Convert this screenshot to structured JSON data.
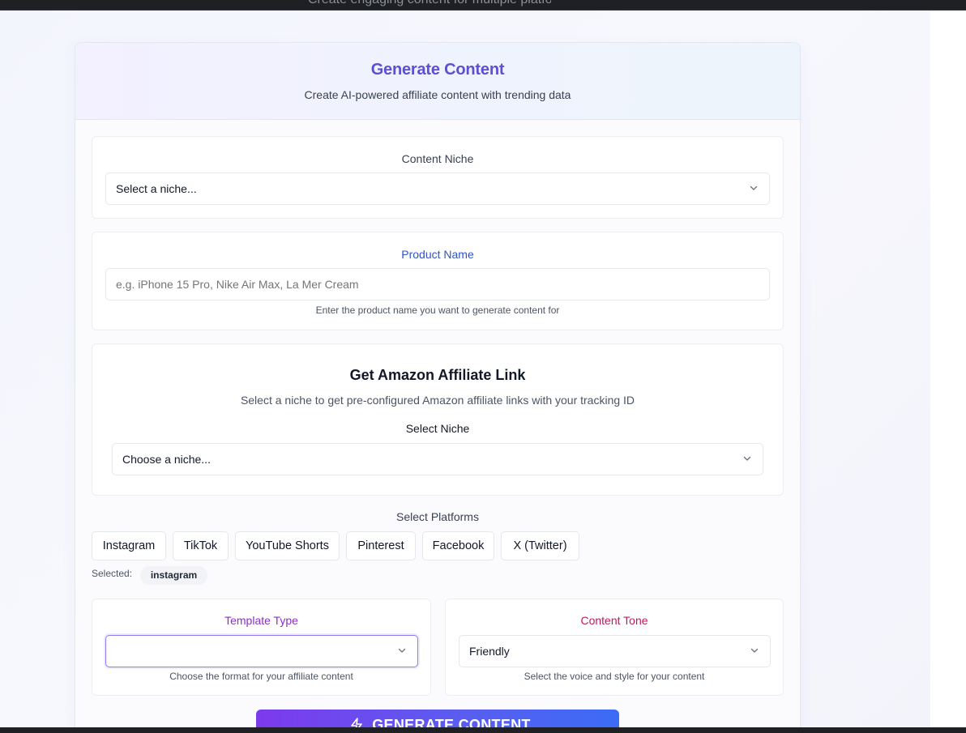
{
  "top_fragment": "Create engaging content for multiple platforms",
  "header": {
    "title": "Generate Content",
    "subtitle": "Create AI-powered affiliate content with trending data"
  },
  "content_niche": {
    "label": "Content Niche",
    "value": "Select a niche..."
  },
  "product_name": {
    "label": "Product Name",
    "placeholder": "e.g. iPhone 15 Pro, Nike Air Max, La Mer Cream",
    "helper": "Enter the product name you want to generate content for"
  },
  "amazon": {
    "title": "Get Amazon Affiliate Link",
    "subtitle": "Select a niche to get pre-configured Amazon affiliate links with your tracking ID",
    "select_label": "Select Niche",
    "value": "Choose a niche..."
  },
  "platforms": {
    "label": "Select Platforms",
    "items": [
      "Instagram",
      "TikTok",
      "YouTube Shorts",
      "Pinterest",
      "Facebook",
      "X (Twitter)"
    ],
    "selected_label": "Selected:",
    "selected": [
      "instagram"
    ]
  },
  "template_type": {
    "label": "Template Type",
    "value": "",
    "helper": "Choose the format for your affiliate content"
  },
  "content_tone": {
    "label": "Content Tone",
    "value": "Friendly",
    "helper": "Select the voice and style for your content"
  },
  "generate_button": {
    "label": "GENERATE CONTENT"
  },
  "colors": {
    "title": "#5b4fd6",
    "product_label": "#2f55c4",
    "template_label": "#8b2fc9",
    "tone_label": "#c2185b",
    "template_border": "#8b7cf0",
    "button_gradient_start": "#7c3aed",
    "button_gradient_end": "#3b6cf6"
  }
}
